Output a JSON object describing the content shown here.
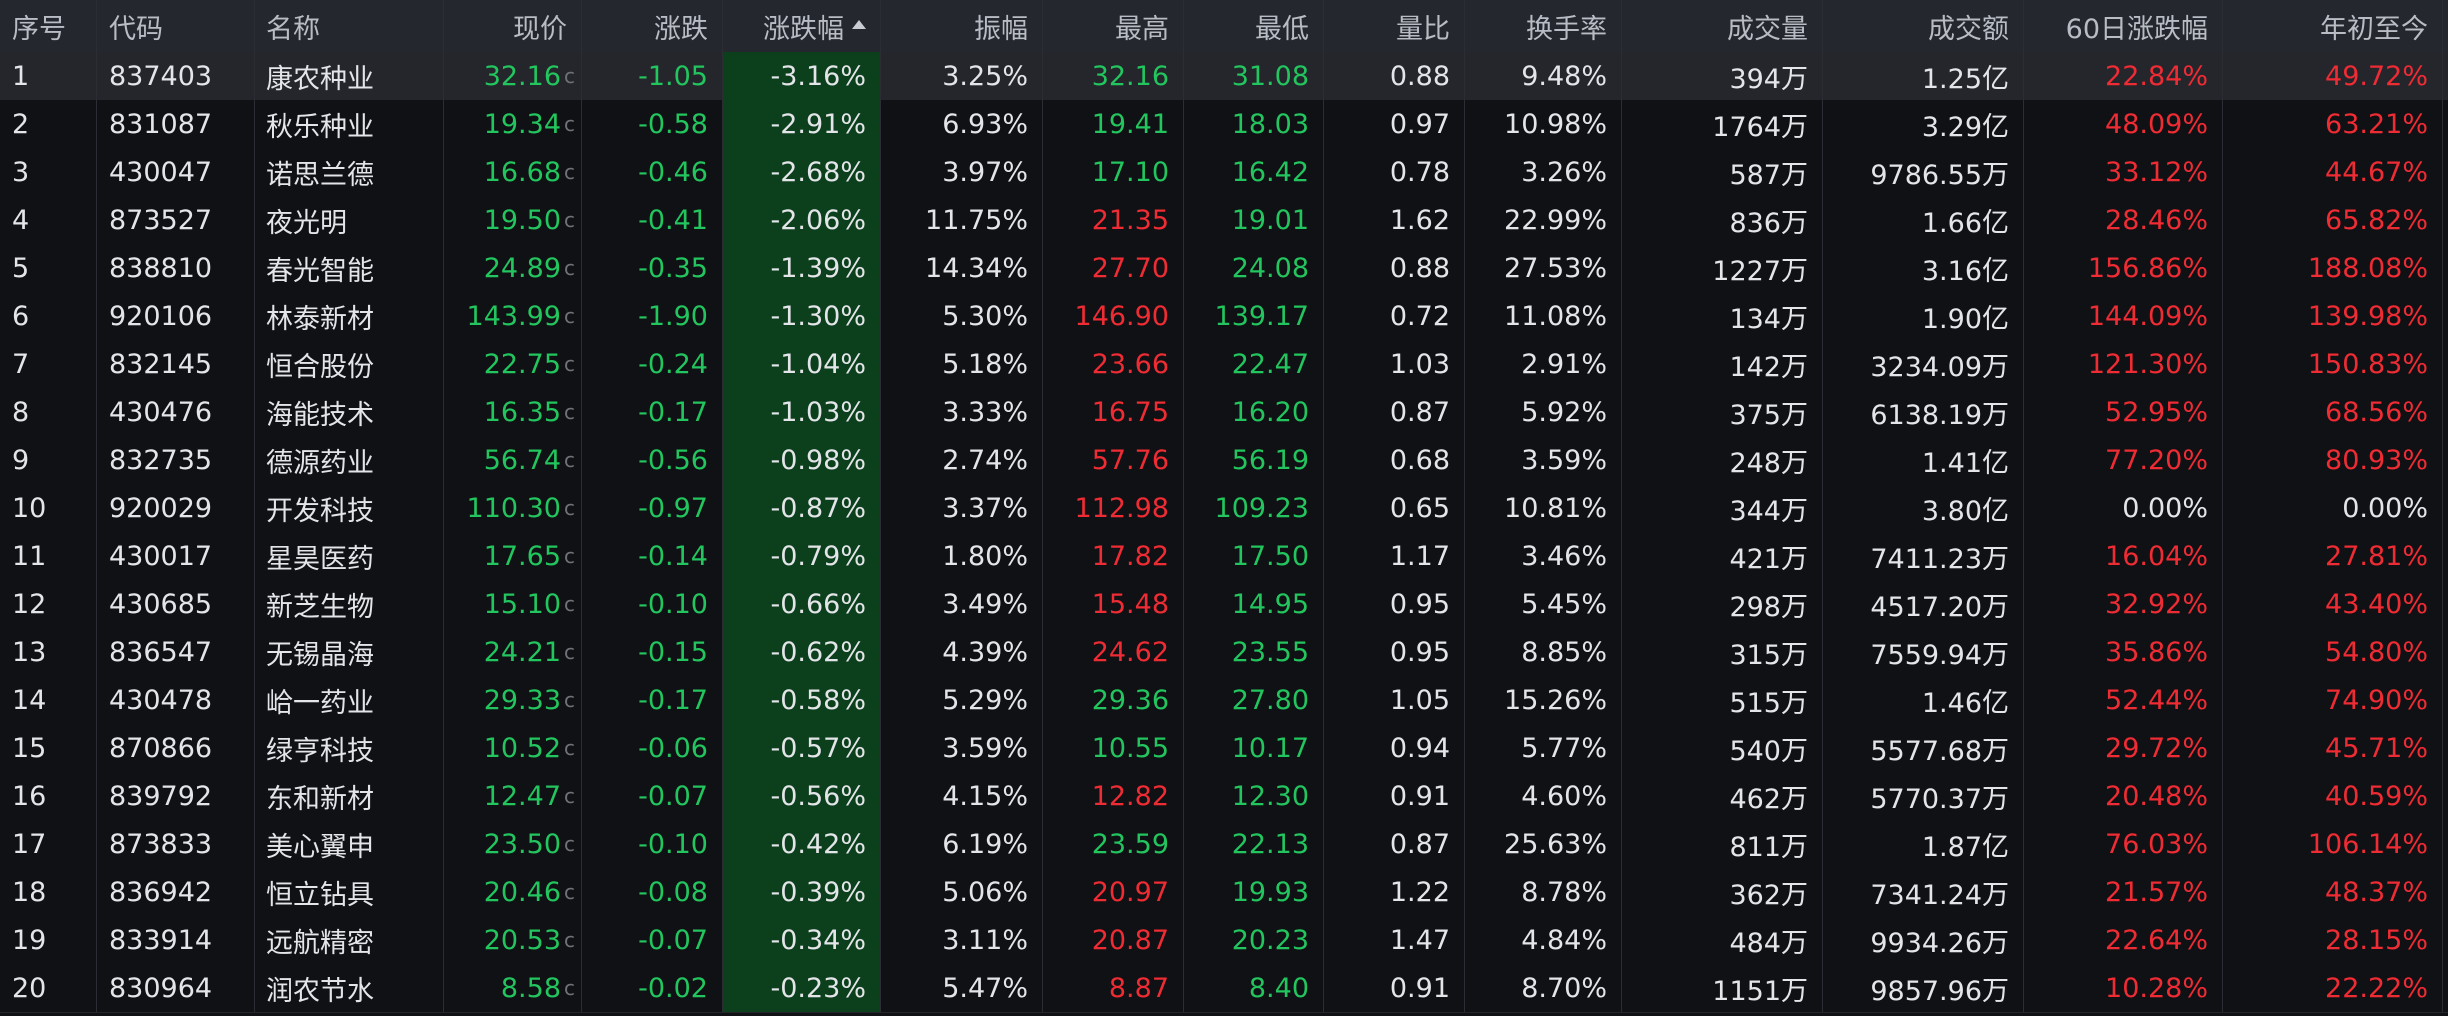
{
  "columns": {
    "idx": "序号",
    "code": "代码",
    "name": "名称",
    "price": "现价",
    "change": "涨跌",
    "pct": "涨跌幅",
    "amp": "振幅",
    "high": "最高",
    "low": "最低",
    "vol_ratio": "量比",
    "turnover": "换手率",
    "volume": "成交量",
    "amount": "成交额",
    "d60": "60日涨跌幅",
    "ytd": "年初至今"
  },
  "sort": {
    "column": "pct",
    "direction": "ascending",
    "icon": "sort-ascending-icon"
  },
  "price_tag": "c",
  "colors": {
    "up": "#ef2b34",
    "down": "#22c55e",
    "neutral": "#e3e5e9",
    "sort_col_bg": "#0c3f1c",
    "header_bg": "#24272d"
  },
  "rows": [
    {
      "idx": "1",
      "code": "837403",
      "name": "康农种业",
      "price": "32.16",
      "change": "-1.05",
      "pct": "-3.16%",
      "amp": "3.25%",
      "high": "32.16",
      "low": "31.08",
      "vol_ratio": "0.88",
      "turnover": "9.48%",
      "volume": "394万",
      "amount": "1.25亿",
      "d60": "22.84%",
      "ytd": "49.72%",
      "high_dir": "down",
      "low_dir": "down",
      "d60_dir": "up",
      "ytd_dir": "up"
    },
    {
      "idx": "2",
      "code": "831087",
      "name": "秋乐种业",
      "price": "19.34",
      "change": "-0.58",
      "pct": "-2.91%",
      "amp": "6.93%",
      "high": "19.41",
      "low": "18.03",
      "vol_ratio": "0.97",
      "turnover": "10.98%",
      "volume": "1764万",
      "amount": "3.29亿",
      "d60": "48.09%",
      "ytd": "63.21%",
      "high_dir": "down",
      "low_dir": "down",
      "d60_dir": "up",
      "ytd_dir": "up"
    },
    {
      "idx": "3",
      "code": "430047",
      "name": "诺思兰德",
      "price": "16.68",
      "change": "-0.46",
      "pct": "-2.68%",
      "amp": "3.97%",
      "high": "17.10",
      "low": "16.42",
      "vol_ratio": "0.78",
      "turnover": "3.26%",
      "volume": "587万",
      "amount": "9786.55万",
      "d60": "33.12%",
      "ytd": "44.67%",
      "high_dir": "down",
      "low_dir": "down",
      "d60_dir": "up",
      "ytd_dir": "up"
    },
    {
      "idx": "4",
      "code": "873527",
      "name": "夜光明",
      "price": "19.50",
      "change": "-0.41",
      "pct": "-2.06%",
      "amp": "11.75%",
      "high": "21.35",
      "low": "19.01",
      "vol_ratio": "1.62",
      "turnover": "22.99%",
      "volume": "836万",
      "amount": "1.66亿",
      "d60": "28.46%",
      "ytd": "65.82%",
      "high_dir": "up",
      "low_dir": "down",
      "d60_dir": "up",
      "ytd_dir": "up"
    },
    {
      "idx": "5",
      "code": "838810",
      "name": "春光智能",
      "price": "24.89",
      "change": "-0.35",
      "pct": "-1.39%",
      "amp": "14.34%",
      "high": "27.70",
      "low": "24.08",
      "vol_ratio": "0.88",
      "turnover": "27.53%",
      "volume": "1227万",
      "amount": "3.16亿",
      "d60": "156.86%",
      "ytd": "188.08%",
      "high_dir": "up",
      "low_dir": "down",
      "d60_dir": "up",
      "ytd_dir": "up"
    },
    {
      "idx": "6",
      "code": "920106",
      "name": "林泰新材",
      "price": "143.99",
      "change": "-1.90",
      "pct": "-1.30%",
      "amp": "5.30%",
      "high": "146.90",
      "low": "139.17",
      "vol_ratio": "0.72",
      "turnover": "11.08%",
      "volume": "134万",
      "amount": "1.90亿",
      "d60": "144.09%",
      "ytd": "139.98%",
      "high_dir": "up",
      "low_dir": "down",
      "d60_dir": "up",
      "ytd_dir": "up"
    },
    {
      "idx": "7",
      "code": "832145",
      "name": "恒合股份",
      "price": "22.75",
      "change": "-0.24",
      "pct": "-1.04%",
      "amp": "5.18%",
      "high": "23.66",
      "low": "22.47",
      "vol_ratio": "1.03",
      "turnover": "2.91%",
      "volume": "142万",
      "amount": "3234.09万",
      "d60": "121.30%",
      "ytd": "150.83%",
      "high_dir": "up",
      "low_dir": "down",
      "d60_dir": "up",
      "ytd_dir": "up"
    },
    {
      "idx": "8",
      "code": "430476",
      "name": "海能技术",
      "price": "16.35",
      "change": "-0.17",
      "pct": "-1.03%",
      "amp": "3.33%",
      "high": "16.75",
      "low": "16.20",
      "vol_ratio": "0.87",
      "turnover": "5.92%",
      "volume": "375万",
      "amount": "6138.19万",
      "d60": "52.95%",
      "ytd": "68.56%",
      "high_dir": "up",
      "low_dir": "down",
      "d60_dir": "up",
      "ytd_dir": "up"
    },
    {
      "idx": "9",
      "code": "832735",
      "name": "德源药业",
      "price": "56.74",
      "change": "-0.56",
      "pct": "-0.98%",
      "amp": "2.74%",
      "high": "57.76",
      "low": "56.19",
      "vol_ratio": "0.68",
      "turnover": "3.59%",
      "volume": "248万",
      "amount": "1.41亿",
      "d60": "77.20%",
      "ytd": "80.93%",
      "high_dir": "up",
      "low_dir": "down",
      "d60_dir": "up",
      "ytd_dir": "up"
    },
    {
      "idx": "10",
      "code": "920029",
      "name": "开发科技",
      "price": "110.30",
      "change": "-0.97",
      "pct": "-0.87%",
      "amp": "3.37%",
      "high": "112.98",
      "low": "109.23",
      "vol_ratio": "0.65",
      "turnover": "10.81%",
      "volume": "344万",
      "amount": "3.80亿",
      "d60": "0.00%",
      "ytd": "0.00%",
      "high_dir": "up",
      "low_dir": "down",
      "d60_dir": "flat",
      "ytd_dir": "flat"
    },
    {
      "idx": "11",
      "code": "430017",
      "name": "星昊医药",
      "price": "17.65",
      "change": "-0.14",
      "pct": "-0.79%",
      "amp": "1.80%",
      "high": "17.82",
      "low": "17.50",
      "vol_ratio": "1.17",
      "turnover": "3.46%",
      "volume": "421万",
      "amount": "7411.23万",
      "d60": "16.04%",
      "ytd": "27.81%",
      "high_dir": "up",
      "low_dir": "down",
      "d60_dir": "up",
      "ytd_dir": "up"
    },
    {
      "idx": "12",
      "code": "430685",
      "name": "新芝生物",
      "price": "15.10",
      "change": "-0.10",
      "pct": "-0.66%",
      "amp": "3.49%",
      "high": "15.48",
      "low": "14.95",
      "vol_ratio": "0.95",
      "turnover": "5.45%",
      "volume": "298万",
      "amount": "4517.20万",
      "d60": "32.92%",
      "ytd": "43.40%",
      "high_dir": "up",
      "low_dir": "down",
      "d60_dir": "up",
      "ytd_dir": "up"
    },
    {
      "idx": "13",
      "code": "836547",
      "name": "无锡晶海",
      "price": "24.21",
      "change": "-0.15",
      "pct": "-0.62%",
      "amp": "4.39%",
      "high": "24.62",
      "low": "23.55",
      "vol_ratio": "0.95",
      "turnover": "8.85%",
      "volume": "315万",
      "amount": "7559.94万",
      "d60": "35.86%",
      "ytd": "54.80%",
      "high_dir": "up",
      "low_dir": "down",
      "d60_dir": "up",
      "ytd_dir": "up"
    },
    {
      "idx": "14",
      "code": "430478",
      "name": "峆一药业",
      "price": "29.33",
      "change": "-0.17",
      "pct": "-0.58%",
      "amp": "5.29%",
      "high": "29.36",
      "low": "27.80",
      "vol_ratio": "1.05",
      "turnover": "15.26%",
      "volume": "515万",
      "amount": "1.46亿",
      "d60": "52.44%",
      "ytd": "74.90%",
      "high_dir": "down",
      "low_dir": "down",
      "d60_dir": "up",
      "ytd_dir": "up"
    },
    {
      "idx": "15",
      "code": "870866",
      "name": "绿亨科技",
      "price": "10.52",
      "change": "-0.06",
      "pct": "-0.57%",
      "amp": "3.59%",
      "high": "10.55",
      "low": "10.17",
      "vol_ratio": "0.94",
      "turnover": "5.77%",
      "volume": "540万",
      "amount": "5577.68万",
      "d60": "29.72%",
      "ytd": "45.71%",
      "high_dir": "down",
      "low_dir": "down",
      "d60_dir": "up",
      "ytd_dir": "up"
    },
    {
      "idx": "16",
      "code": "839792",
      "name": "东和新材",
      "price": "12.47",
      "change": "-0.07",
      "pct": "-0.56%",
      "amp": "4.15%",
      "high": "12.82",
      "low": "12.30",
      "vol_ratio": "0.91",
      "turnover": "4.60%",
      "volume": "462万",
      "amount": "5770.37万",
      "d60": "20.48%",
      "ytd": "40.59%",
      "high_dir": "up",
      "low_dir": "down",
      "d60_dir": "up",
      "ytd_dir": "up"
    },
    {
      "idx": "17",
      "code": "873833",
      "name": "美心翼申",
      "price": "23.50",
      "change": "-0.10",
      "pct": "-0.42%",
      "amp": "6.19%",
      "high": "23.59",
      "low": "22.13",
      "vol_ratio": "0.87",
      "turnover": "25.63%",
      "volume": "811万",
      "amount": "1.87亿",
      "d60": "76.03%",
      "ytd": "106.14%",
      "high_dir": "down",
      "low_dir": "down",
      "d60_dir": "up",
      "ytd_dir": "up"
    },
    {
      "idx": "18",
      "code": "836942",
      "name": "恒立钻具",
      "price": "20.46",
      "change": "-0.08",
      "pct": "-0.39%",
      "amp": "5.06%",
      "high": "20.97",
      "low": "19.93",
      "vol_ratio": "1.22",
      "turnover": "8.78%",
      "volume": "362万",
      "amount": "7341.24万",
      "d60": "21.57%",
      "ytd": "48.37%",
      "high_dir": "up",
      "low_dir": "down",
      "d60_dir": "up",
      "ytd_dir": "up"
    },
    {
      "idx": "19",
      "code": "833914",
      "name": "远航精密",
      "price": "20.53",
      "change": "-0.07",
      "pct": "-0.34%",
      "amp": "3.11%",
      "high": "20.87",
      "low": "20.23",
      "vol_ratio": "1.47",
      "turnover": "4.84%",
      "volume": "484万",
      "amount": "9934.26万",
      "d60": "22.64%",
      "ytd": "28.15%",
      "high_dir": "up",
      "low_dir": "down",
      "d60_dir": "up",
      "ytd_dir": "up"
    },
    {
      "idx": "20",
      "code": "830964",
      "name": "润农节水",
      "price": "8.58",
      "change": "-0.02",
      "pct": "-0.23%",
      "amp": "5.47%",
      "high": "8.87",
      "low": "8.40",
      "vol_ratio": "0.91",
      "turnover": "8.70%",
      "volume": "1151万",
      "amount": "9857.96万",
      "d60": "10.28%",
      "ytd": "22.22%",
      "high_dir": "up",
      "low_dir": "down",
      "d60_dir": "up",
      "ytd_dir": "up"
    }
  ]
}
